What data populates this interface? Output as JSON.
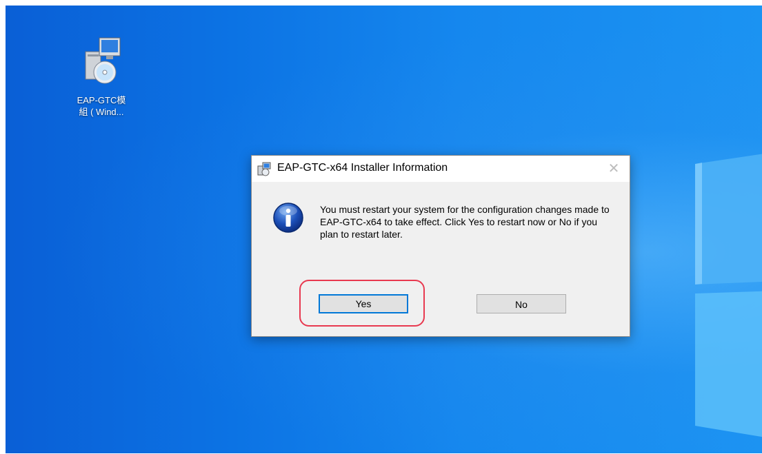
{
  "desktop": {
    "icon": {
      "icon_name": "installer-package-icon",
      "label": "EAP-GTC模組 ( Wind..."
    }
  },
  "dialog": {
    "title": "EAP-GTC-x64 Installer Information",
    "title_icon": "installer-icon",
    "close_label": "✕",
    "info_icon": "info-icon",
    "message": "You must restart your system for the configuration changes made to EAP-GTC-x64 to take effect. Click Yes to restart now or No if you plan to restart later.",
    "buttons": {
      "yes": "Yes",
      "no": "No"
    },
    "highlight_color": "#e8384f"
  }
}
